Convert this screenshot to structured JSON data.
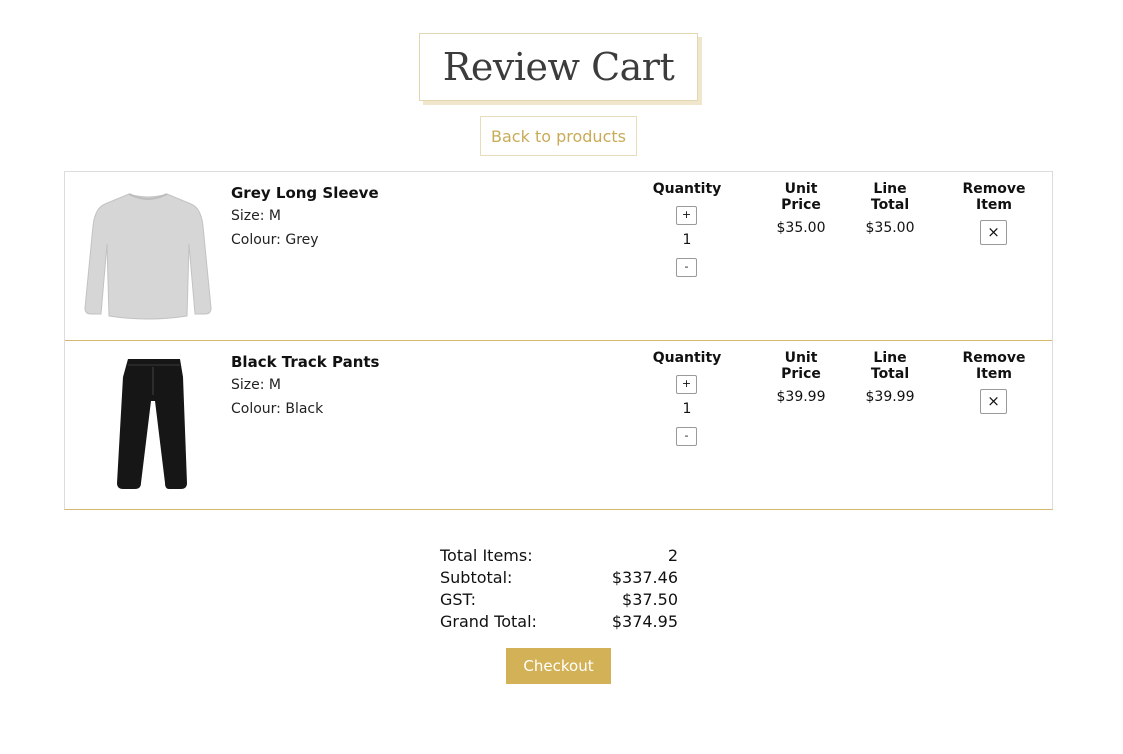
{
  "page": {
    "title": "Review Cart",
    "back_label": "Back to products",
    "checkout_label": "Checkout"
  },
  "columns": {
    "quantity": "Quantity",
    "unit_price": "Unit Price",
    "line_total": "Line Total",
    "remove_item": "Remove Item"
  },
  "items": [
    {
      "name": "Grey Long Sleeve",
      "size": "Size: M",
      "colour": "Colour: Grey",
      "quantity": "1",
      "unit_price": "$35.00",
      "line_total": "$35.00",
      "plus": "+",
      "minus": "-",
      "remove": "×",
      "image_color": "#d6d6d6"
    },
    {
      "name": "Black Track Pants",
      "size": "Size: M",
      "colour": "Colour: Black",
      "quantity": "1",
      "unit_price": "$39.99",
      "line_total": "$39.99",
      "plus": "+",
      "minus": "-",
      "remove": "×",
      "image_color": "#161616"
    }
  ],
  "summary": {
    "total_items_label": "Total Items:",
    "total_items_value": "2",
    "subtotal_label": "Subtotal:",
    "subtotal_value": "$337.46",
    "gst_label": "GST:",
    "gst_value": "$37.50",
    "grand_total_label": "Grand Total:",
    "grand_total_value": "$374.95"
  },
  "colors": {
    "accent": "#d3b157",
    "accent_text": "#c9ab57",
    "divider": "#d4b872"
  }
}
